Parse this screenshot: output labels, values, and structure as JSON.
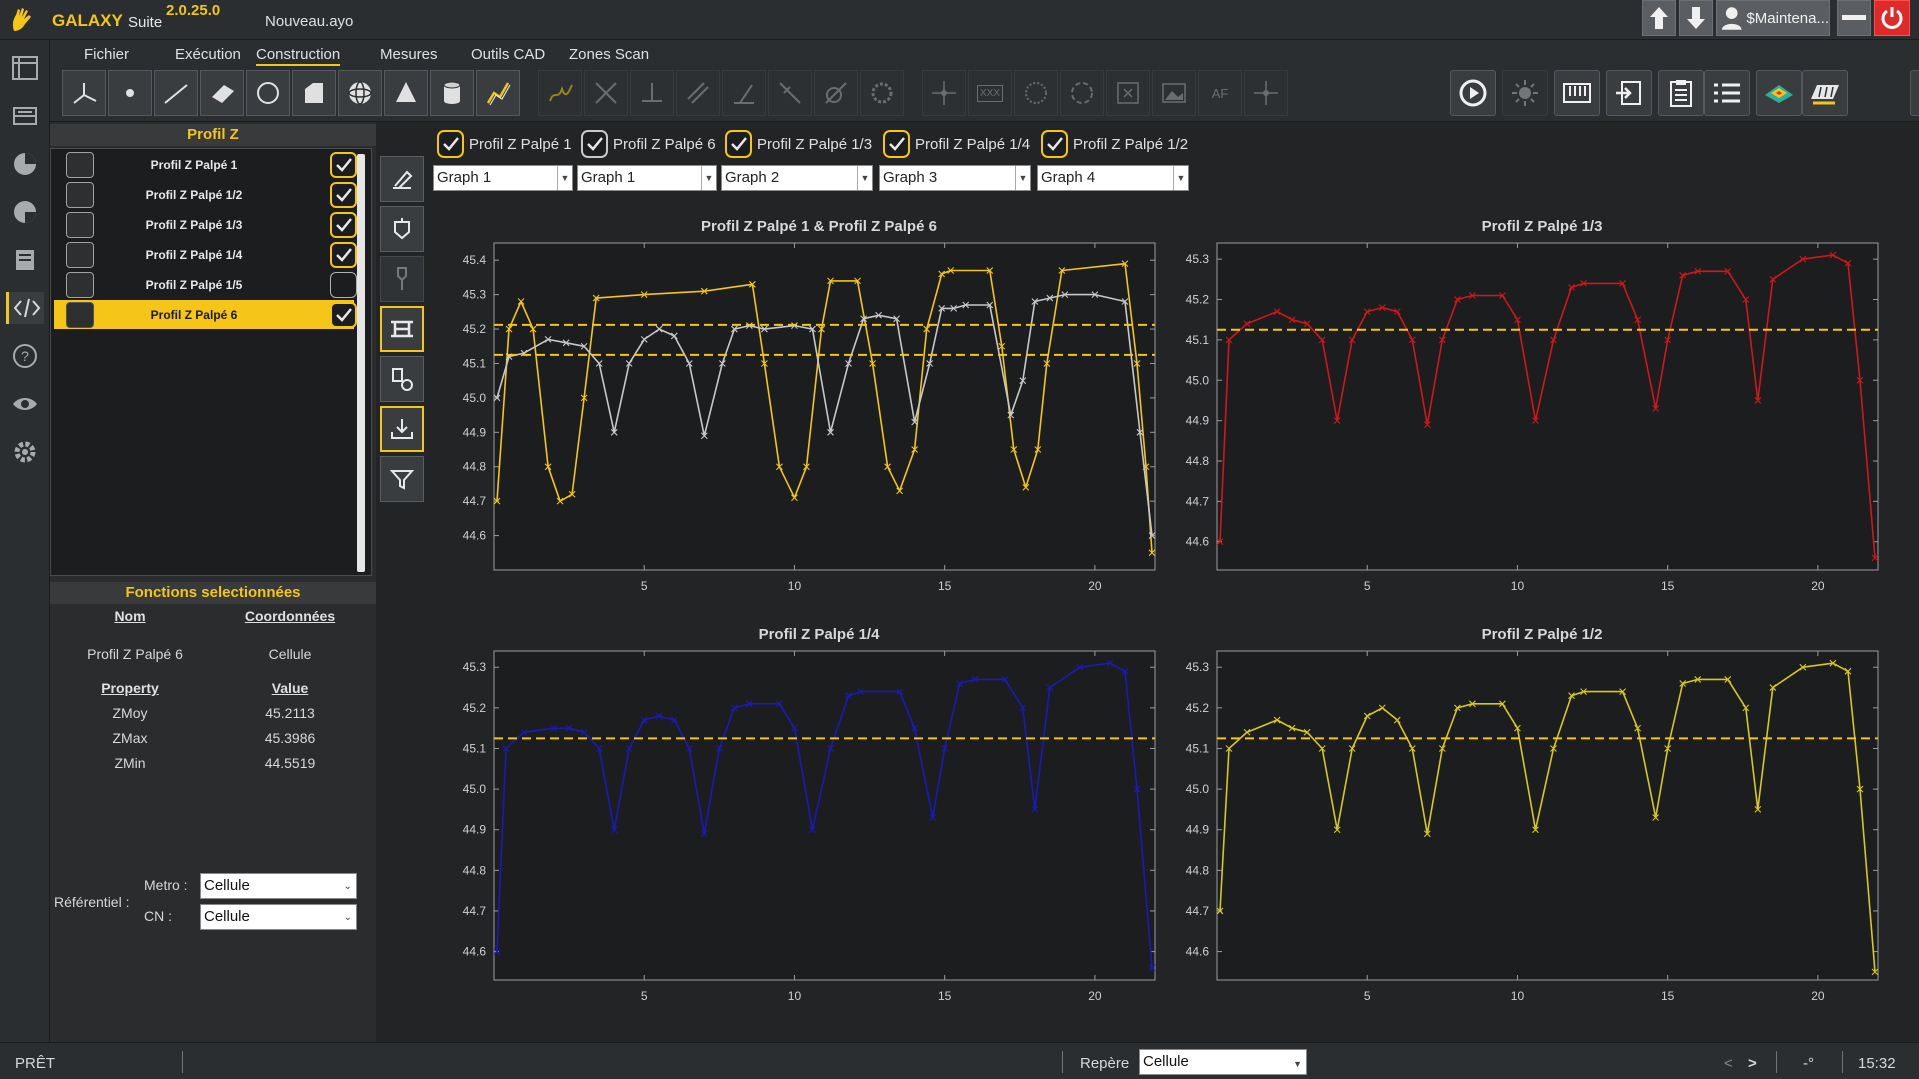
{
  "app": {
    "name": "GALAXY",
    "suite": "Suite",
    "version": "2.0.25.0",
    "file": "Nouveau.ayo",
    "user": "$Maintena...",
    "icons": {
      "logo": "galaxy-hand-icon",
      "upload": "arrow-up-icon",
      "download": "arrow-down-icon",
      "user": "user-icon",
      "minimize": "minimize-icon",
      "power": "power-icon"
    }
  },
  "menu": {
    "items": [
      "Fichier",
      "Exécution",
      "Construction",
      "Mesures",
      "Outils CAD",
      "Zones Scan"
    ],
    "active": "Construction"
  },
  "rail": {
    "icons": [
      "frame-icon",
      "inbox-icon",
      "pie-chart-icon",
      "pie-chart-alt-icon",
      "book-icon",
      "code-icon",
      "help-icon",
      "eye-icon",
      "settings-icon"
    ],
    "active": "code-icon"
  },
  "toolbar": {
    "tools": [
      "axis-icon",
      "point-icon",
      "line-icon",
      "plane-icon",
      "circle-icon",
      "slot-icon",
      "sphere-icon",
      "cone-icon",
      "cylinder-icon",
      "curve-icon"
    ],
    "disabled_tools": [
      "spring-icon",
      "intersect-icon",
      "project-icon",
      "parallel-icon",
      "perpendicular-icon",
      "symmetric-icon",
      "tangent-icon",
      "gear-icon",
      "centroid-icon",
      "xxx-icon",
      "pattern-icon",
      "circle-pattern-icon",
      "frame-x-icon",
      "image-icon",
      "af-icon",
      "target-icon"
    ],
    "af_label": "AF",
    "xxx_label": "XXX",
    "right_tools": [
      "run-icon",
      "sun-icon",
      "keyboard-icon",
      "export-icon",
      "clipboard-icon",
      "list-icon",
      "surface-map-icon",
      "scan-icon",
      "print-icon"
    ]
  },
  "left_panel": {
    "header": "Profil Z",
    "profiles": [
      {
        "name": "Profil Z Palpé 1",
        "checked": true,
        "selected": false
      },
      {
        "name": "Profil Z Palpé 1/2",
        "checked": true,
        "selected": false
      },
      {
        "name": "Profil Z Palpé 1/3",
        "checked": true,
        "selected": false
      },
      {
        "name": "Profil Z Palpé 1/4",
        "checked": true,
        "selected": false
      },
      {
        "name": "Profil Z Palpé 1/5",
        "checked": false,
        "selected": false
      },
      {
        "name": "Profil Z Palpé 6",
        "checked": true,
        "selected": true
      }
    ],
    "functions": {
      "header": "Fonctions selectionnées",
      "col_name": "Nom",
      "col_coord": "Coordonnées",
      "name_value": "Profil Z Palpé 6",
      "coord_value": "Cellule",
      "col_property": "Property",
      "col_value": "Value",
      "props": [
        {
          "name": "ZMoy",
          "value": "45.2113"
        },
        {
          "name": "ZMax",
          "value": "45.3986"
        },
        {
          "name": "ZMin",
          "value": "44.5519"
        }
      ]
    },
    "referentiel": {
      "label": "Référentiel :",
      "metro_label": "Metro :",
      "metro_value": "Cellule",
      "cn_label": "CN :",
      "cn_value": "Cellule"
    }
  },
  "func_icons": [
    "edit-path-icon",
    "probe-icon",
    "probe-tip-icon",
    "profile-icon",
    "sensor-icon",
    "import-icon",
    "filter-icon"
  ],
  "graph_selectors": [
    {
      "label": "Profil Z Palpé 1",
      "graph": "Graph 1",
      "color": "yellow"
    },
    {
      "label": "Profil Z Palpé 6",
      "graph": "Graph 1",
      "color": "white"
    },
    {
      "label": "Profil Z Palpé 1/3",
      "graph": "Graph 2",
      "color": "yellow"
    },
    {
      "label": "Profil Z Palpé 1/4",
      "graph": "Graph 3",
      "color": "yellow"
    },
    {
      "label": "Profil Z Palpé 1/2",
      "graph": "Graph 4",
      "color": "yellow"
    }
  ],
  "chart_data": [
    {
      "type": "line",
      "title": "Profil Z Palpé 1 & Profil Z Palpé 6",
      "xlim": [
        0,
        22
      ],
      "ylim": [
        44.5,
        45.45
      ],
      "x_ticks": [
        5,
        10,
        15,
        20
      ],
      "y_ticks": [
        44.6,
        44.7,
        44.8,
        44.9,
        45.0,
        45.1,
        45.2,
        45.3,
        45.4
      ],
      "hlines": [
        45.212,
        45.125
      ],
      "series": [
        {
          "color": "#f5c518",
          "x": [
            0.1,
            0.5,
            0.9,
            1.3,
            1.8,
            2.2,
            2.6,
            3.0,
            3.4,
            5.0,
            7.0,
            8.6,
            9.0,
            9.5,
            10.0,
            10.4,
            10.9,
            11.2,
            12.1,
            12.6,
            13.1,
            13.5,
            14.0,
            14.4,
            14.9,
            15.2,
            16.5,
            16.9,
            17.3,
            17.7,
            18.1,
            18.4,
            18.9,
            21.0,
            21.4,
            21.7,
            21.9
          ],
          "y": [
            44.7,
            45.2,
            45.28,
            45.2,
            44.8,
            44.7,
            44.72,
            45.0,
            45.29,
            45.3,
            45.31,
            45.33,
            45.1,
            44.8,
            44.71,
            44.8,
            45.2,
            45.34,
            45.34,
            45.1,
            44.8,
            44.73,
            44.85,
            45.2,
            45.36,
            45.37,
            45.37,
            45.15,
            44.85,
            44.74,
            44.85,
            45.1,
            45.37,
            45.39,
            45.1,
            44.8,
            44.55
          ]
        },
        {
          "color": "#c8c8c8",
          "x": [
            0.1,
            0.5,
            1.0,
            1.8,
            2.4,
            3.0,
            3.5,
            4.0,
            4.5,
            5.0,
            5.5,
            6.0,
            6.5,
            7.0,
            7.6,
            8.0,
            8.5,
            9.0,
            10.0,
            10.6,
            11.2,
            11.8,
            12.3,
            12.8,
            13.4,
            14.0,
            14.5,
            14.9,
            15.3,
            15.7,
            16.5,
            17.2,
            17.6,
            18.0,
            18.5,
            19.0,
            20.0,
            21.0,
            21.5,
            21.9
          ],
          "y": [
            45.0,
            45.12,
            45.13,
            45.17,
            45.16,
            45.15,
            45.1,
            44.9,
            45.1,
            45.17,
            45.2,
            45.18,
            45.1,
            44.89,
            45.1,
            45.2,
            45.21,
            45.2,
            45.21,
            45.2,
            44.9,
            45.1,
            45.23,
            45.24,
            45.23,
            44.93,
            45.1,
            45.26,
            45.26,
            45.27,
            45.27,
            44.95,
            45.05,
            45.28,
            45.29,
            45.3,
            45.3,
            45.28,
            44.9,
            44.6
          ]
        }
      ]
    },
    {
      "type": "line",
      "title": "Profil Z Palpé 1/3",
      "xlim": [
        0,
        22
      ],
      "ylim": [
        44.53,
        45.34
      ],
      "x_ticks": [
        5,
        10,
        15,
        20
      ],
      "y_ticks": [
        44.6,
        44.7,
        44.8,
        44.9,
        45.0,
        45.1,
        45.2,
        45.3
      ],
      "hlines": [
        45.125
      ],
      "series": [
        {
          "color": "#d01818",
          "x": [
            0.1,
            0.4,
            1.0,
            2.0,
            2.5,
            3.0,
            3.5,
            4.0,
            4.5,
            5.0,
            5.5,
            6.0,
            6.5,
            7.0,
            7.5,
            8.0,
            8.5,
            9.5,
            10.0,
            10.6,
            11.2,
            11.8,
            12.2,
            13.5,
            14.0,
            14.6,
            15.0,
            15.5,
            16.0,
            17.0,
            17.6,
            18.0,
            18.5,
            19.5,
            20.5,
            21.0,
            21.4,
            21.9
          ],
          "y": [
            44.6,
            45.1,
            45.14,
            45.17,
            45.15,
            45.14,
            45.1,
            44.9,
            45.1,
            45.17,
            45.18,
            45.17,
            45.1,
            44.89,
            45.1,
            45.2,
            45.21,
            45.21,
            45.15,
            44.9,
            45.1,
            45.23,
            45.24,
            45.24,
            45.15,
            44.93,
            45.1,
            45.26,
            45.27,
            45.27,
            45.2,
            44.95,
            45.25,
            45.3,
            45.31,
            45.29,
            45.0,
            44.56
          ]
        }
      ]
    },
    {
      "type": "line",
      "title": "Profil Z Palpé 1/4",
      "xlim": [
        0,
        22
      ],
      "ylim": [
        44.53,
        45.34
      ],
      "x_ticks": [
        5,
        10,
        15,
        20
      ],
      "y_ticks": [
        44.6,
        44.7,
        44.8,
        44.9,
        45.0,
        45.1,
        45.2,
        45.3
      ],
      "hlines": [
        45.125
      ],
      "series": [
        {
          "color": "#1a1ab8",
          "x": [
            0.1,
            0.4,
            1.0,
            2.0,
            2.5,
            3.0,
            3.5,
            4.0,
            4.5,
            5.0,
            5.5,
            6.0,
            6.5,
            7.0,
            7.5,
            8.0,
            8.5,
            9.5,
            10.0,
            10.6,
            11.2,
            11.8,
            12.2,
            13.5,
            14.0,
            14.6,
            15.0,
            15.5,
            16.0,
            17.0,
            17.6,
            18.0,
            18.5,
            19.5,
            20.5,
            21.0,
            21.4,
            21.9
          ],
          "y": [
            44.6,
            45.1,
            45.14,
            45.15,
            45.15,
            45.14,
            45.1,
            44.9,
            45.1,
            45.17,
            45.18,
            45.17,
            45.1,
            44.89,
            45.1,
            45.2,
            45.21,
            45.21,
            45.15,
            44.9,
            45.1,
            45.23,
            45.24,
            45.24,
            45.15,
            44.93,
            45.1,
            45.26,
            45.27,
            45.27,
            45.2,
            44.95,
            45.25,
            45.3,
            45.31,
            45.29,
            45.0,
            44.56
          ]
        }
      ]
    },
    {
      "type": "line",
      "title": "Profil Z Palpé 1/2",
      "xlim": [
        0,
        22
      ],
      "ylim": [
        44.53,
        45.34
      ],
      "x_ticks": [
        5,
        10,
        15,
        20
      ],
      "y_ticks": [
        44.6,
        44.7,
        44.8,
        44.9,
        45.0,
        45.1,
        45.2,
        45.3
      ],
      "hlines": [
        45.125
      ],
      "series": [
        {
          "color": "#d8c81c",
          "x": [
            0.1,
            0.4,
            1.0,
            2.0,
            2.5,
            3.0,
            3.5,
            4.0,
            4.5,
            5.0,
            5.5,
            6.0,
            6.5,
            7.0,
            7.5,
            8.0,
            8.5,
            9.5,
            10.0,
            10.6,
            11.2,
            11.8,
            12.2,
            13.5,
            14.0,
            14.6,
            15.0,
            15.5,
            16.0,
            17.0,
            17.6,
            18.0,
            18.5,
            19.5,
            20.5,
            21.0,
            21.4,
            21.9
          ],
          "y": [
            44.7,
            45.1,
            45.14,
            45.17,
            45.15,
            45.14,
            45.1,
            44.9,
            45.1,
            45.18,
            45.2,
            45.17,
            45.1,
            44.89,
            45.1,
            45.2,
            45.21,
            45.21,
            45.15,
            44.9,
            45.1,
            45.23,
            45.24,
            45.24,
            45.15,
            44.93,
            45.1,
            45.26,
            45.27,
            45.27,
            45.2,
            44.95,
            45.25,
            45.3,
            45.31,
            45.29,
            45.0,
            44.55
          ]
        }
      ]
    }
  ],
  "statusbar": {
    "status": "PRÊT",
    "repere_label": "Repère",
    "repere_value": "Cellule",
    "nav_prev": "<",
    "nav_next": ">",
    "angle": "-°",
    "time": "15:32"
  }
}
